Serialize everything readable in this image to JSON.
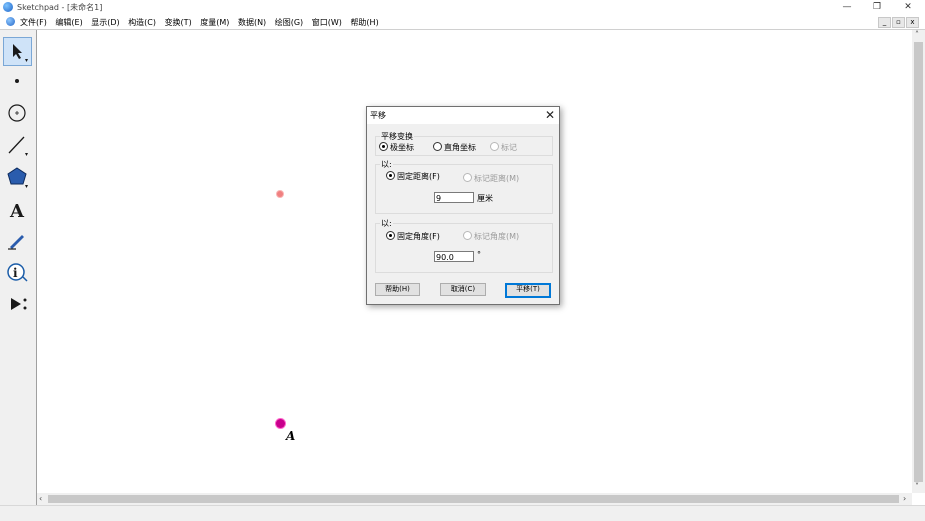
{
  "window": {
    "title": "Sketchpad  - [未命名1]",
    "minimize": "—",
    "restore": "❐",
    "close": "✕"
  },
  "menubar": {
    "items": [
      {
        "label": "文件(F)"
      },
      {
        "label": "编辑(E)"
      },
      {
        "label": "显示(D)"
      },
      {
        "label": "构造(C)"
      },
      {
        "label": "变换(T)"
      },
      {
        "label": "度量(M)"
      },
      {
        "label": "数据(N)"
      },
      {
        "label": "绘图(G)"
      },
      {
        "label": "窗口(W)"
      },
      {
        "label": "帮助(H)"
      }
    ],
    "mdi_minimize": "_",
    "mdi_restore": "▫",
    "mdi_close": "x"
  },
  "toolbox": {
    "tools": [
      "arrow-select-icon",
      "point-icon",
      "compass-icon",
      "straightedge-icon",
      "polygon-icon",
      "text-icon",
      "marker-icon",
      "information-icon",
      "custom-tool-icon"
    ],
    "text_tool_glyph": "A"
  },
  "canvas": {
    "point_label": "A"
  },
  "dialog": {
    "title": "平移",
    "close": "✕",
    "translation_group": {
      "label": "平移变换",
      "options": [
        {
          "label": "极坐标",
          "selected": true,
          "enabled": true
        },
        {
          "label": "直角坐标",
          "selected": false,
          "enabled": true
        },
        {
          "label": "标记",
          "selected": false,
          "enabled": false
        }
      ]
    },
    "distance_group": {
      "label": "以:",
      "fixed_label": "固定距离(F)",
      "marked_label": "标记距离(M)",
      "value": "9",
      "unit": "厘米"
    },
    "angle_group": {
      "label": "以:",
      "fixed_label": "固定角度(F)",
      "marked_label": "标记角度(M)",
      "value": "90.0",
      "unit": "°"
    },
    "buttons": {
      "help": "帮助(H)",
      "cancel": "取消(C)",
      "translate": "平移(T)"
    }
  },
  "colors": {
    "point_fill": "#c8008c",
    "point_ring": "#ff66cc",
    "faint_point": "#f08080",
    "default_button_border": "#0078d7"
  }
}
